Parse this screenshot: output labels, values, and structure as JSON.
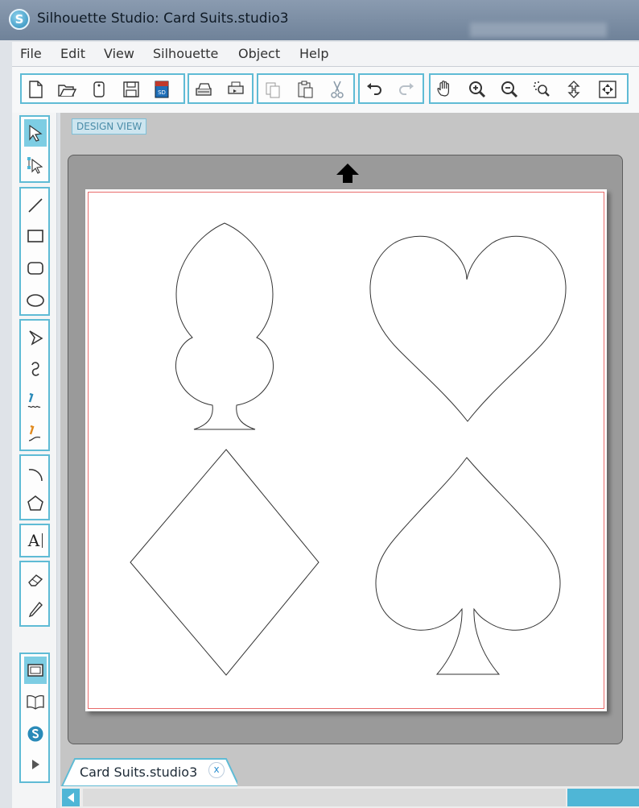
{
  "window": {
    "title": "Silhouette Studio: Card Suits.studio3",
    "logo_letter": "S"
  },
  "menu": [
    "File",
    "Edit",
    "View",
    "Silhouette",
    "Object",
    "Help"
  ],
  "toolbar": {
    "groups": [
      {
        "name": "file",
        "icons": [
          "new-document-icon",
          "open-folder-icon",
          "open-library-icon",
          "save-icon",
          "save-to-sd-icon"
        ]
      },
      {
        "name": "send",
        "icons": [
          "send-to-cutter-icon",
          "print-icon"
        ]
      },
      {
        "name": "clipboard",
        "icons": [
          "copy-icon",
          "paste-icon",
          "cut-icon"
        ]
      },
      {
        "name": "history",
        "icons": [
          "undo-icon",
          "redo-icon"
        ]
      },
      {
        "name": "view",
        "icons": [
          "pan-hand-icon",
          "zoom-in-icon",
          "zoom-out-icon",
          "zoom-select-icon",
          "zoom-fit-page-icon",
          "fit-to-window-icon"
        ]
      }
    ],
    "sd_badge": "SD"
  },
  "left_tools": {
    "groups": [
      [
        "select-tool-icon",
        "point-edit-tool-icon"
      ],
      [
        "line-tool-icon",
        "rectangle-tool-icon",
        "rounded-rectangle-tool-icon",
        "ellipse-tool-icon"
      ],
      [
        "polygon-tool-icon",
        "curve-tool-icon",
        "freehand-tool-icon",
        "smooth-freehand-tool-icon"
      ],
      [
        "arc-tool-icon",
        "regular-polygon-tool-icon"
      ],
      [
        "text-tool-icon"
      ],
      [
        "eraser-tool-icon",
        "knife-tool-icon"
      ],
      [
        "design-page-icon",
        "library-icon",
        "silhouette-store-icon",
        "expand-arrow-icon"
      ]
    ],
    "text_tool_label": "A"
  },
  "canvas": {
    "view_label": "DESIGN VIEW",
    "shapes": [
      "club",
      "heart",
      "diamond",
      "spade"
    ]
  },
  "document_tab": {
    "label": "Card Suits.studio3",
    "close": "x"
  },
  "colors": {
    "accent": "#5fbbd5",
    "active_tool": "#7dcde3",
    "cut_border": "#e86a6a",
    "mat": "#9a9a9a",
    "canvas_bg": "#c5c5c5"
  }
}
